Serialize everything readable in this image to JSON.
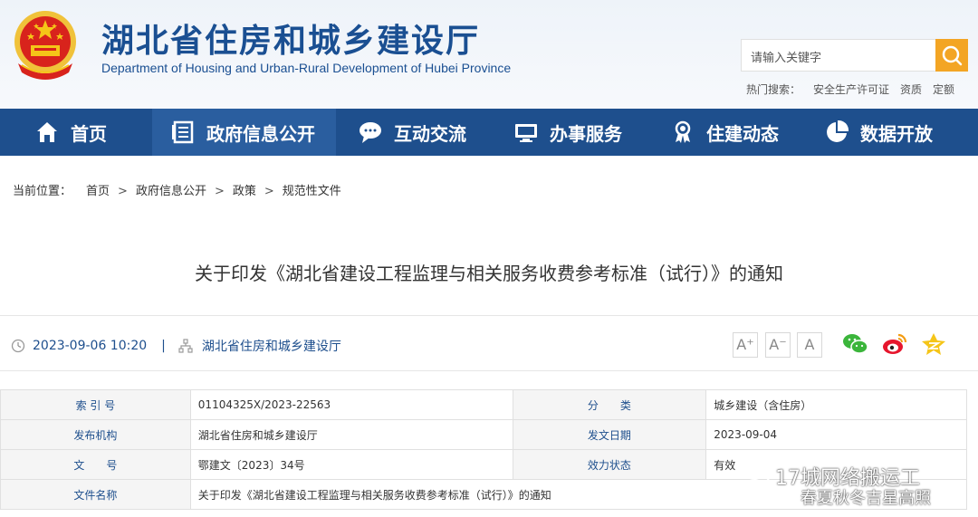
{
  "header": {
    "title": "湖北省住房和城乡建设厅",
    "subtitle": "Department of Housing and Urban-Rural Development of Hubei Province",
    "search_placeholder": "请输入关键字",
    "hot_search_label": "热门搜索：",
    "hot_search_items": [
      "安全生产许可证",
      "资质",
      "定额"
    ]
  },
  "nav": {
    "items": [
      {
        "label": "首页",
        "icon": "home-icon"
      },
      {
        "label": "政府信息公开",
        "icon": "document-list-icon",
        "active": true
      },
      {
        "label": "互动交流",
        "icon": "chat-bubble-icon"
      },
      {
        "label": "办事服务",
        "icon": "monitor-icon"
      },
      {
        "label": "住建动态",
        "icon": "award-icon"
      },
      {
        "label": "数据开放",
        "icon": "pie-chart-icon"
      }
    ]
  },
  "breadcrumb": {
    "label": "当前位置：",
    "items": [
      "首页",
      "政府信息公开",
      "政策",
      "规范性文件"
    ],
    "separator": ">"
  },
  "article": {
    "title": "关于印发《湖北省建设工程监理与相关服务收费参考标准（试行）》的通知",
    "datetime": "2023-09-06 10:20",
    "separator": "|",
    "publisher": "湖北省住房和城乡建设厅",
    "font_sizes": [
      "A⁺",
      "A⁻",
      "A"
    ]
  },
  "info_table": {
    "rows": [
      {
        "label1": "索 引 号",
        "value1": "01104325X/2023-22563",
        "label2": "分　　类",
        "value2": "城乡建设（含住房）"
      },
      {
        "label1": "发布机构",
        "value1": "湖北省住房和城乡建设厅",
        "label2": "发文日期",
        "value2": "2023-09-04"
      },
      {
        "label1": "文　　号",
        "value1": "鄂建文〔2023〕34号",
        "label2": "效力状态",
        "value2": "有效"
      },
      {
        "label1": "文件名称",
        "value1": "关于印发《湖北省建设工程监理与相关服务收费参考标准（试行）》的通知"
      }
    ]
  },
  "watermark": {
    "line1": "17城网络搬运工",
    "line2": "春夏秋冬吉星高照"
  },
  "colors": {
    "brand_blue": "#1e4f8d",
    "nav_active": "#2a5e9f",
    "search_orange": "#f3a524",
    "emblem_red": "#d8231c",
    "emblem_gold": "#f5c518"
  }
}
